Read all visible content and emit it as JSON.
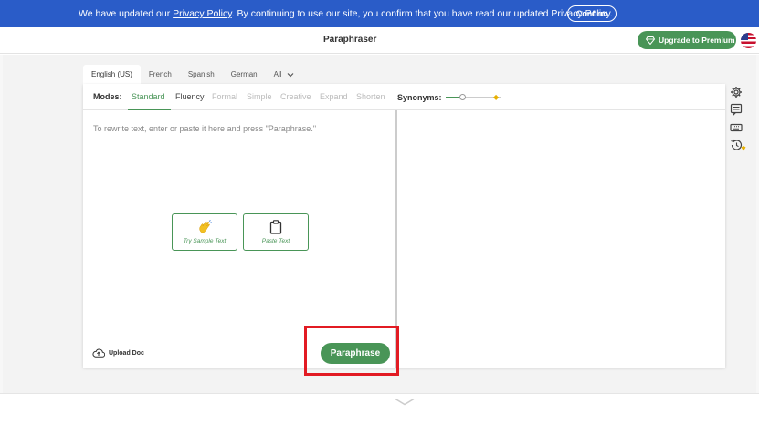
{
  "banner": {
    "text_before": "We have updated our ",
    "link_text": "Privacy Policy",
    "text_after": ". By continuing to use our site, you confirm that you have read our updated Privacy Policy.",
    "confirm_label": "Confirm"
  },
  "header": {
    "title": "Paraphraser",
    "upgrade_label": "Upgrade to Premium",
    "upgrade_icon": "diamond-icon",
    "flag_icon": "us-flag-icon"
  },
  "languages": {
    "tabs": [
      "English (US)",
      "French",
      "Spanish",
      "German",
      "All"
    ],
    "active": "English (US)"
  },
  "modes": {
    "label": "Modes:",
    "items": [
      "Standard",
      "Fluency",
      "Formal",
      "Simple",
      "Creative",
      "Expand",
      "Shorten"
    ],
    "active": "Standard"
  },
  "synonyms": {
    "label": "Synonyms:",
    "level_fraction": 0.3
  },
  "editor": {
    "placeholder": "To rewrite text, enter or paste it here and press \"Paraphrase.\"",
    "sample_label": "Try Sample Text",
    "paste_label": "Paste Text",
    "upload_label": "Upload Doc",
    "paraphrase_label": "Paraphrase"
  },
  "sidebar": {
    "icons": [
      "gear-icon",
      "comment-icon",
      "keyboard-icon",
      "history-icon"
    ]
  },
  "colors": {
    "banner_blue": "#2a5cc8",
    "brand_green": "#499557",
    "highlight_red": "#e21b23",
    "premium_gold": "#e8b000"
  }
}
